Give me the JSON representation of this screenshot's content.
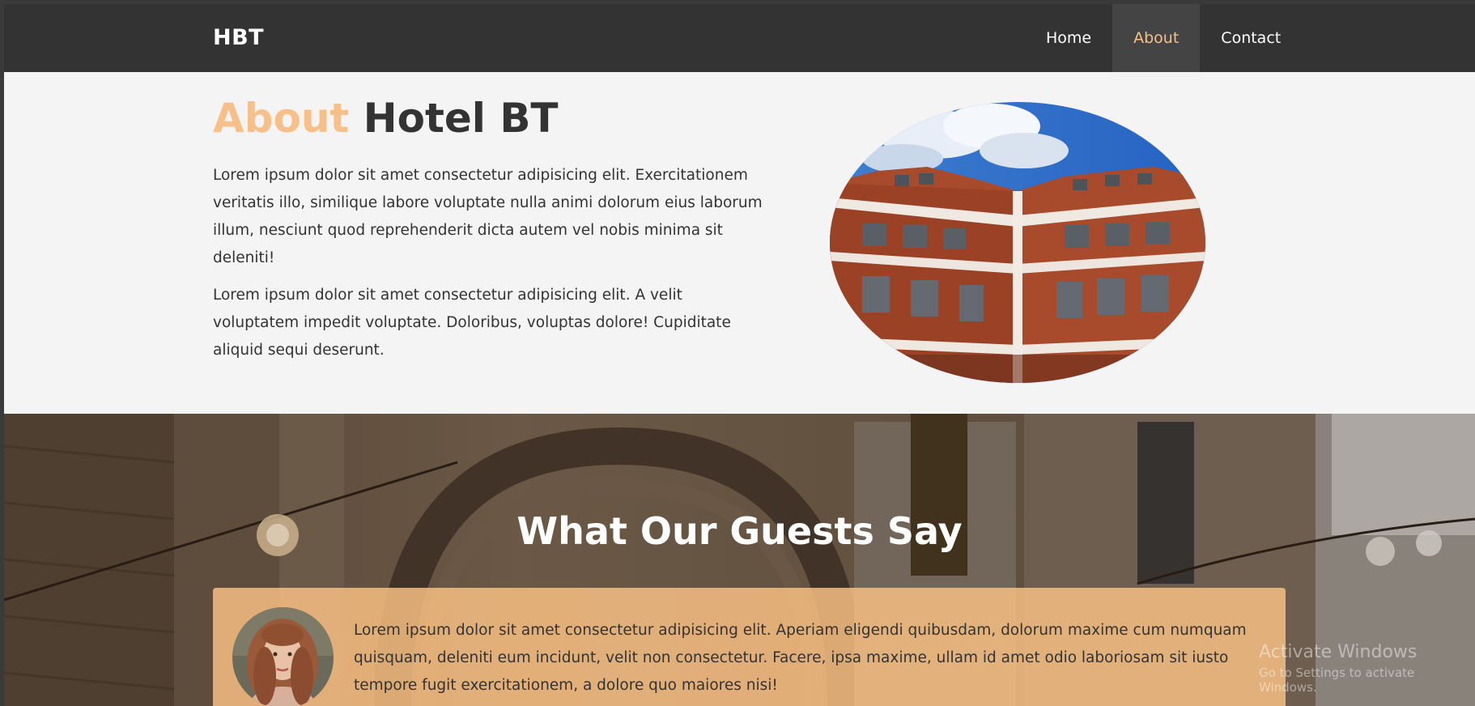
{
  "nav": {
    "brand": "HBT",
    "links": [
      {
        "label": "Home",
        "active": false
      },
      {
        "label": "About",
        "active": true
      },
      {
        "label": "Contact",
        "active": false
      }
    ]
  },
  "about": {
    "title_accent": "About",
    "title_rest": "Hotel BT",
    "paragraphs": [
      "Lorem ipsum dolor sit amet consectetur adipisicing elit. Exercitationem veritatis illo, similique labore voluptate nulla animi dolorum eius laborum illum, nesciunt quod reprehenderit dicta autem vel nobis minima sit deleniti!",
      "Lorem ipsum dolor sit amet consectetur adipisicing elit. A velit voluptatem impedit voluptate. Doloribus, voluptas dolore! Cupiditate aliquid sequi deserunt."
    ]
  },
  "guests": {
    "title": "What Our Guests Say",
    "testimonial": "Lorem ipsum dolor sit amet consectetur adipisicing elit. Aperiam eligendi quibusdam, dolorum maxime cum numquam quisquam, deleniti eum incidunt, velit non consectetur. Facere, ipsa maxime, ullam id amet odio laboriosam sit iusto tempore fugit exercitationem, a dolore quo maiores nisi!"
  },
  "watermark": {
    "title": "Activate Windows",
    "subtitle": "Go to Settings to activate Windows."
  },
  "colors": {
    "accent": "#f7c08a",
    "navbar": "#333333",
    "text": "#333333",
    "card": "#f7be82"
  }
}
